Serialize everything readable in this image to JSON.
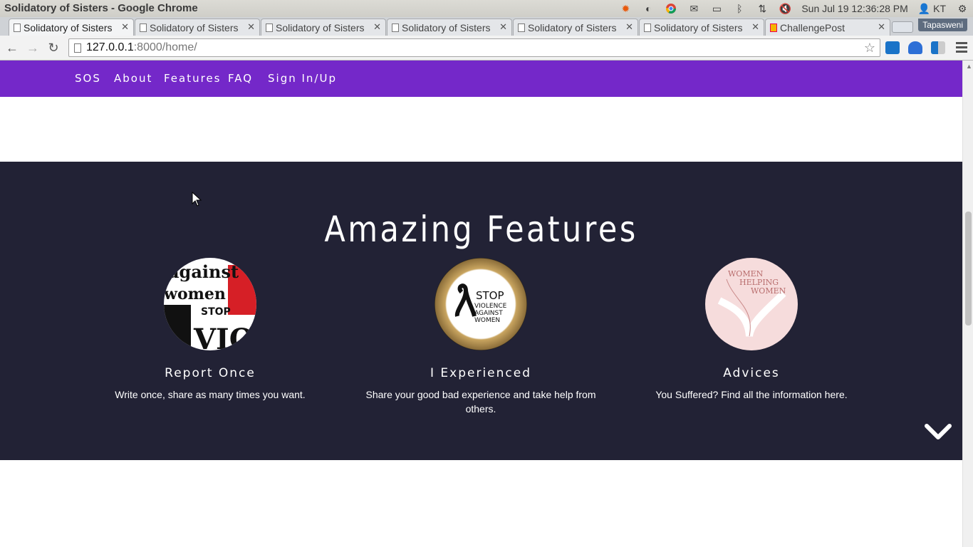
{
  "window": {
    "title": "Solidatory of Sisters - Google Chrome"
  },
  "tray": {
    "clock": "Sun Jul 19 12:36:28 PM",
    "user": "KT"
  },
  "tabs": [
    {
      "label": "Solidatory of Sisters",
      "active": true
    },
    {
      "label": "Solidatory of Sisters"
    },
    {
      "label": "Solidatory of Sisters"
    },
    {
      "label": "Solidatory of Sisters"
    },
    {
      "label": "Solidatory of Sisters"
    },
    {
      "label": "Solidatory of Sisters"
    },
    {
      "label": "ChallengePost"
    }
  ],
  "profile": {
    "name": "Tapasweni"
  },
  "omnibox": {
    "host": "127.0.0.1",
    "path": ":8000/home/"
  },
  "site_nav": {
    "items": [
      "SOS",
      "About",
      "Features",
      "FAQ",
      "Sign In/Up"
    ]
  },
  "features": {
    "heading": "Amazing Features",
    "items": [
      {
        "name": "Report Once",
        "desc": "Write once, share as many times you want."
      },
      {
        "name": "I Experienced",
        "desc": "Share your good bad experience and take help from others."
      },
      {
        "name": "Advices",
        "desc": "You Suffered? Find all the information here."
      }
    ],
    "badges": {
      "report": [
        "against",
        "women",
        "STOP",
        "VIO"
      ],
      "stop": [
        "STOP",
        "VIOLENCE",
        "AGAINST",
        "WOMEN"
      ],
      "helping": [
        "WOMEN",
        "HELPING",
        "WOMEN"
      ]
    }
  },
  "colors": {
    "nav": "#7428c9",
    "features_bg": "#222235"
  }
}
